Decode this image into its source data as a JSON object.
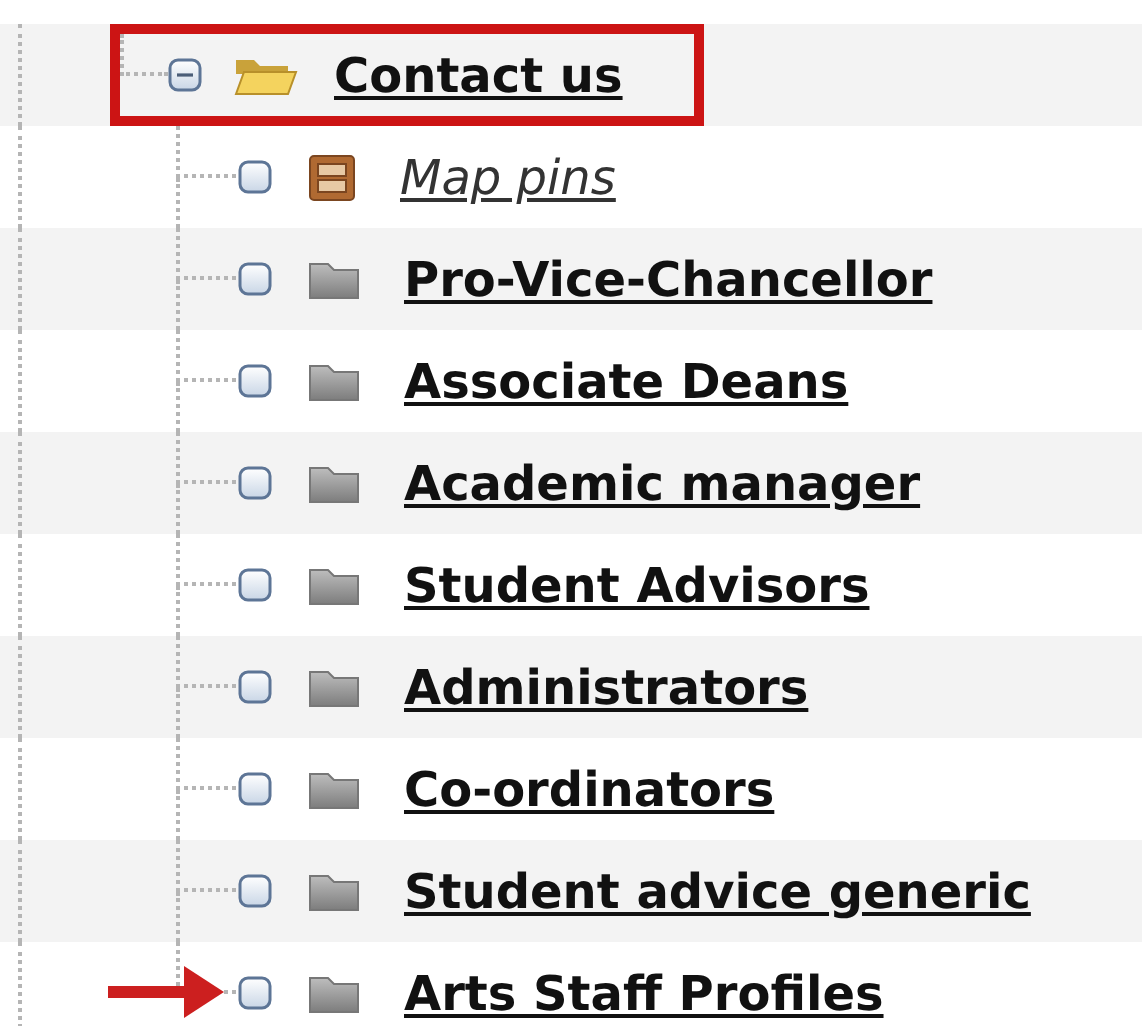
{
  "tree": {
    "label": "Contact us",
    "kind": "folder",
    "expanded": true,
    "highlighted": true,
    "children": [
      {
        "label": "Map pins",
        "kind": "map",
        "checked": false,
        "pointer": false
      },
      {
        "label": "Pro-Vice-Chancellor",
        "kind": "folder",
        "checked": false,
        "pointer": false
      },
      {
        "label": "Associate Deans",
        "kind": "folder",
        "checked": false,
        "pointer": false
      },
      {
        "label": "Academic manager",
        "kind": "folder",
        "checked": false,
        "pointer": false
      },
      {
        "label": "Student Advisors",
        "kind": "folder",
        "checked": false,
        "pointer": false
      },
      {
        "label": "Administrators",
        "kind": "folder",
        "checked": false,
        "pointer": false
      },
      {
        "label": "Co-ordinators",
        "kind": "folder",
        "checked": false,
        "pointer": false
      },
      {
        "label": "Student advice generic",
        "kind": "folder",
        "checked": false,
        "pointer": false
      },
      {
        "label": "Arts Staff Profiles",
        "kind": "folder",
        "checked": false,
        "pointer": true
      }
    ]
  }
}
